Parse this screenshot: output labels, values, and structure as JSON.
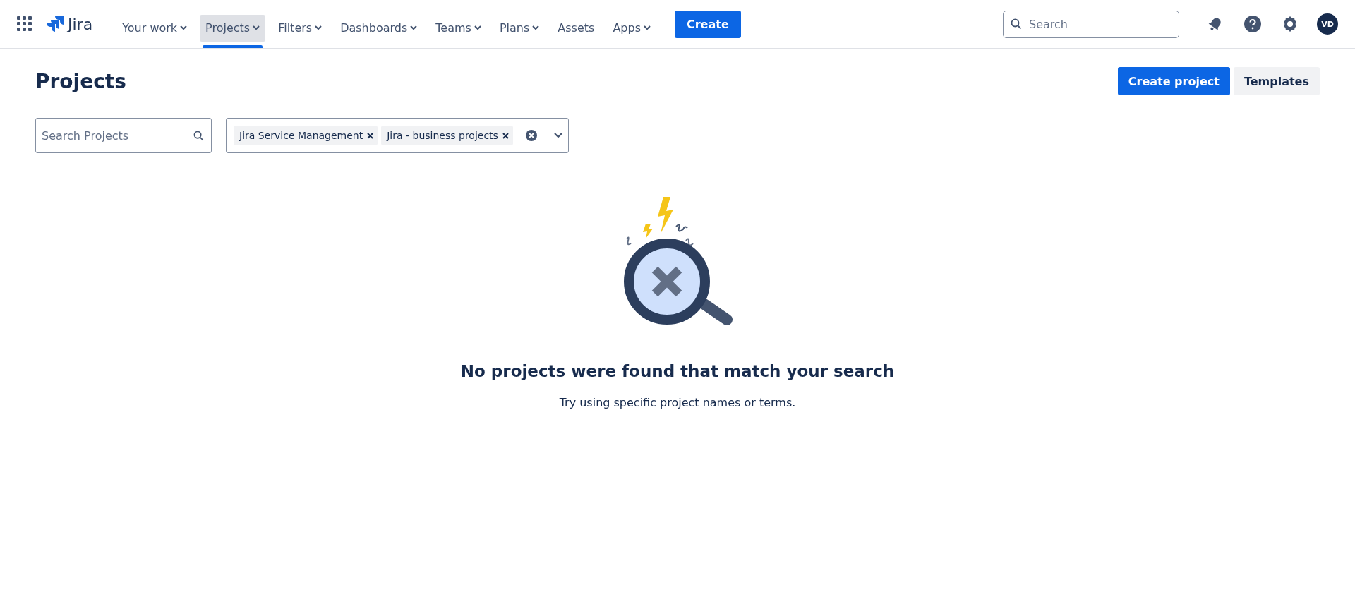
{
  "nav": {
    "product": "Jira",
    "items": [
      {
        "label": "Your work",
        "menu": true,
        "selected": false
      },
      {
        "label": "Projects",
        "menu": true,
        "selected": true
      },
      {
        "label": "Filters",
        "menu": true,
        "selected": false
      },
      {
        "label": "Dashboards",
        "menu": true,
        "selected": false
      },
      {
        "label": "Teams",
        "menu": true,
        "selected": false
      },
      {
        "label": "Plans",
        "menu": true,
        "selected": false
      },
      {
        "label": "Assets",
        "menu": false,
        "selected": false
      },
      {
        "label": "Apps",
        "menu": true,
        "selected": false
      }
    ],
    "create": "Create",
    "search": {
      "placeholder": "Search"
    },
    "avatar": "VD"
  },
  "page": {
    "title": "Projects",
    "actions": [
      {
        "label": "Create project",
        "kind": "primary"
      },
      {
        "label": "Templates",
        "kind": "secondary"
      }
    ]
  },
  "filters": {
    "search": {
      "placeholder": "Search Projects"
    },
    "tags": [
      "Jira Service Management",
      "Jira - business projects"
    ]
  },
  "empty": {
    "heading": "No projects were found that match your search",
    "hint": "Try using specific project names or terms."
  }
}
